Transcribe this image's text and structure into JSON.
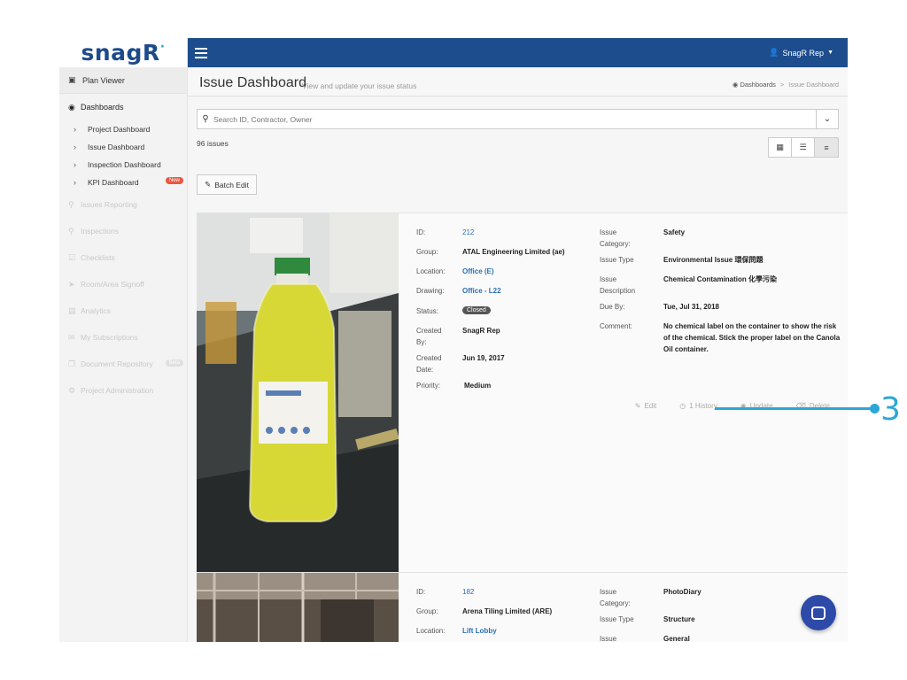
{
  "sidebar": {
    "logo": "snagR",
    "plan_viewer": "Plan Viewer",
    "dashboards": "Dashboards",
    "sub_items": [
      "Project Dashboard",
      "Issue Dashboard",
      "Inspection Dashboard",
      "KPI Dashboard"
    ],
    "new_badge": "New",
    "faded_items": [
      "Issues Reporting",
      "Inspections",
      "Checklists",
      "Room/Area Signoff",
      "Analytics",
      "My Subscriptions",
      "Document Repository",
      "Project Administration"
    ],
    "beta_badge": "Beta"
  },
  "topbar": {
    "user": "SnagR Rep"
  },
  "header": {
    "title": "Issue Dashboard",
    "subtitle": "View and update your issue status",
    "breadcrumb": [
      "Dashboards",
      "Issue Dashboard"
    ]
  },
  "search": {
    "placeholder": "Search ID, Contractor, Owner"
  },
  "issue_count": "96 issues",
  "batch_edit": "Batch Edit",
  "labels": {
    "id": "ID:",
    "group": "Group:",
    "location": "Location:",
    "drawing": "Drawing:",
    "status": "Status:",
    "created_by": "Created By:",
    "created_date": "Created Date:",
    "priority": "Priority:",
    "issue_category": "Issue Category:",
    "issue_type": "Issue Type",
    "issue_description": "Issue Description",
    "due_by": "Due By:",
    "comment": "Comment:"
  },
  "issues": [
    {
      "id": "212",
      "group": "ATAL Engineering Limited  (ae)",
      "location": "Office (E)",
      "drawing": "Office - L22",
      "status": "Closed",
      "created_by": "SnagR Rep",
      "created_date": "Jun 19, 2017",
      "priority": "Medium",
      "category": "Safety",
      "type": "Environmental Issue 環保問題",
      "description": "Chemical Contamination 化學污染",
      "due_by": "Tue, Jul 31, 2018",
      "comment": "No chemical label on the container to show the risk of the chemical. Stick the proper label on the Canola Oil container.",
      "actions": {
        "edit": "Edit",
        "history": "1 History",
        "update": "Update",
        "delete": "Delete"
      }
    },
    {
      "id": "182",
      "group": "Arena Tiling Limited  (ARE)",
      "location": "Lift Lobby",
      "category": "PhotoDiary",
      "type": "Structure",
      "description": "General"
    }
  ],
  "callout": {
    "number": "3",
    "color": "#2ba7d6"
  },
  "colors": {
    "topbar": "#1e4d8e",
    "link": "#2a6fb8",
    "badge": "#e9573f"
  }
}
